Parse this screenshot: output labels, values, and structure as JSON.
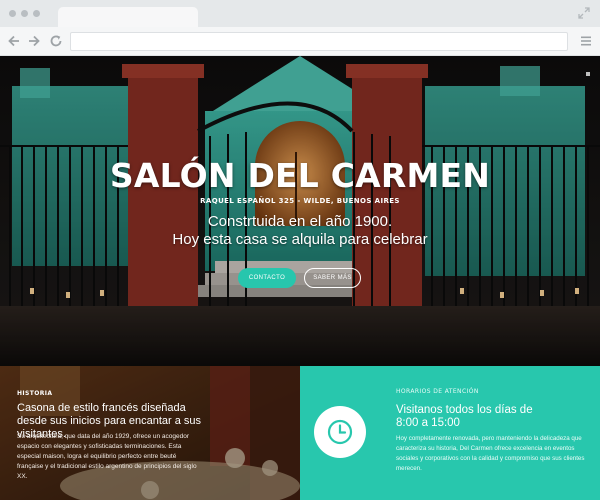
{
  "browser": {
    "icons": [
      "window-dot",
      "expand-icon",
      "back-arrow-icon",
      "forward-arrow-icon",
      "refresh-icon",
      "menu-icon"
    ]
  },
  "hero": {
    "title": "SALÓN DEL CARMEN",
    "address": "RAQUEL ESPAÑOL 325 - WILDE, BUENOS AIRES",
    "tagline_line1": "Constrtuida en el año 1900.",
    "tagline_line2": "Hoy esta casa se alquila para celebrar",
    "contact_label": "CONTACTO",
    "more_label": "SABER MÁS"
  },
  "history": {
    "label": "HISTORIA",
    "heading": "Casona de estilo francés diseñada desde sus inicios para encantar a sus visitantes.",
    "text": "Su arquitectura, que data del año 1929, ofrece un acogedor espacio con elegantes y sofisticadas terminaciones. Esta especial maison, logra el equilibrio perfecto entre beuté française y el tradicional estilo argentino de principios del siglo XX."
  },
  "schedule": {
    "label": "HORARIOS DE ATENCIÓN",
    "heading_line1": "Visitanos todos los días de",
    "heading_line2": "8:00 a 15:00",
    "text": "Hoy completamente renovada, pero manteniendo la delicadeza que caracteriza su historia, Del Carmen ofrece excelencia en eventos sociales y corporativos con la calidad y compromiso que sus clientes merecen.",
    "icon": "clock-icon"
  },
  "colors": {
    "accent": "#28c7ad",
    "browser_bar": "#e5e8ea",
    "nav_bar": "#f5f6f7"
  }
}
